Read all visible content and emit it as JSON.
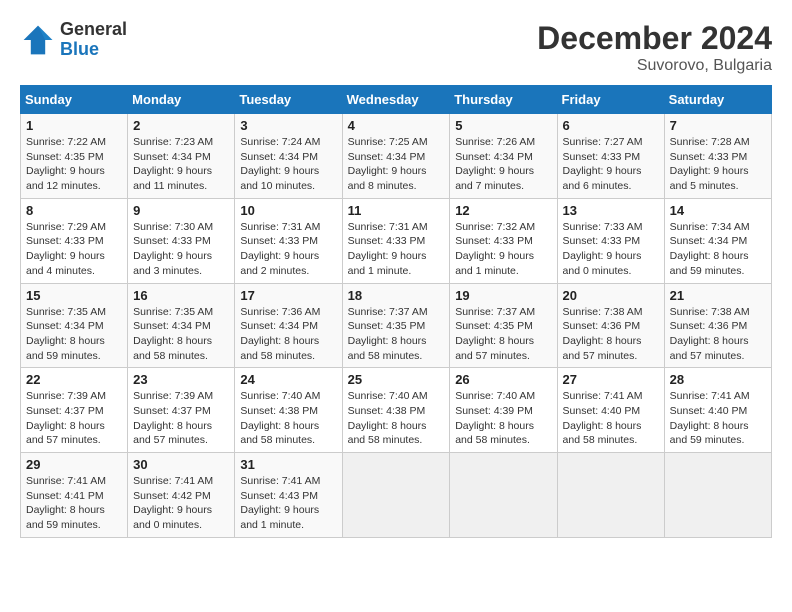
{
  "logo": {
    "line1": "General",
    "line2": "Blue"
  },
  "title": "December 2024",
  "subtitle": "Suvorovo, Bulgaria",
  "weekdays": [
    "Sunday",
    "Monday",
    "Tuesday",
    "Wednesday",
    "Thursday",
    "Friday",
    "Saturday"
  ],
  "weeks": [
    [
      {
        "day": "1",
        "sunrise": "7:22 AM",
        "sunset": "4:35 PM",
        "daylight": "9 hours and 12 minutes."
      },
      {
        "day": "2",
        "sunrise": "7:23 AM",
        "sunset": "4:34 PM",
        "daylight": "9 hours and 11 minutes."
      },
      {
        "day": "3",
        "sunrise": "7:24 AM",
        "sunset": "4:34 PM",
        "daylight": "9 hours and 10 minutes."
      },
      {
        "day": "4",
        "sunrise": "7:25 AM",
        "sunset": "4:34 PM",
        "daylight": "9 hours and 8 minutes."
      },
      {
        "day": "5",
        "sunrise": "7:26 AM",
        "sunset": "4:34 PM",
        "daylight": "9 hours and 7 minutes."
      },
      {
        "day": "6",
        "sunrise": "7:27 AM",
        "sunset": "4:33 PM",
        "daylight": "9 hours and 6 minutes."
      },
      {
        "day": "7",
        "sunrise": "7:28 AM",
        "sunset": "4:33 PM",
        "daylight": "9 hours and 5 minutes."
      }
    ],
    [
      {
        "day": "8",
        "sunrise": "7:29 AM",
        "sunset": "4:33 PM",
        "daylight": "9 hours and 4 minutes."
      },
      {
        "day": "9",
        "sunrise": "7:30 AM",
        "sunset": "4:33 PM",
        "daylight": "9 hours and 3 minutes."
      },
      {
        "day": "10",
        "sunrise": "7:31 AM",
        "sunset": "4:33 PM",
        "daylight": "9 hours and 2 minutes."
      },
      {
        "day": "11",
        "sunrise": "7:31 AM",
        "sunset": "4:33 PM",
        "daylight": "9 hours and 1 minute."
      },
      {
        "day": "12",
        "sunrise": "7:32 AM",
        "sunset": "4:33 PM",
        "daylight": "9 hours and 1 minute."
      },
      {
        "day": "13",
        "sunrise": "7:33 AM",
        "sunset": "4:33 PM",
        "daylight": "9 hours and 0 minutes."
      },
      {
        "day": "14",
        "sunrise": "7:34 AM",
        "sunset": "4:34 PM",
        "daylight": "8 hours and 59 minutes."
      }
    ],
    [
      {
        "day": "15",
        "sunrise": "7:35 AM",
        "sunset": "4:34 PM",
        "daylight": "8 hours and 59 minutes."
      },
      {
        "day": "16",
        "sunrise": "7:35 AM",
        "sunset": "4:34 PM",
        "daylight": "8 hours and 58 minutes."
      },
      {
        "day": "17",
        "sunrise": "7:36 AM",
        "sunset": "4:34 PM",
        "daylight": "8 hours and 58 minutes."
      },
      {
        "day": "18",
        "sunrise": "7:37 AM",
        "sunset": "4:35 PM",
        "daylight": "8 hours and 58 minutes."
      },
      {
        "day": "19",
        "sunrise": "7:37 AM",
        "sunset": "4:35 PM",
        "daylight": "8 hours and 57 minutes."
      },
      {
        "day": "20",
        "sunrise": "7:38 AM",
        "sunset": "4:36 PM",
        "daylight": "8 hours and 57 minutes."
      },
      {
        "day": "21",
        "sunrise": "7:38 AM",
        "sunset": "4:36 PM",
        "daylight": "8 hours and 57 minutes."
      }
    ],
    [
      {
        "day": "22",
        "sunrise": "7:39 AM",
        "sunset": "4:37 PM",
        "daylight": "8 hours and 57 minutes."
      },
      {
        "day": "23",
        "sunrise": "7:39 AM",
        "sunset": "4:37 PM",
        "daylight": "8 hours and 57 minutes."
      },
      {
        "day": "24",
        "sunrise": "7:40 AM",
        "sunset": "4:38 PM",
        "daylight": "8 hours and 58 minutes."
      },
      {
        "day": "25",
        "sunrise": "7:40 AM",
        "sunset": "4:38 PM",
        "daylight": "8 hours and 58 minutes."
      },
      {
        "day": "26",
        "sunrise": "7:40 AM",
        "sunset": "4:39 PM",
        "daylight": "8 hours and 58 minutes."
      },
      {
        "day": "27",
        "sunrise": "7:41 AM",
        "sunset": "4:40 PM",
        "daylight": "8 hours and 58 minutes."
      },
      {
        "day": "28",
        "sunrise": "7:41 AM",
        "sunset": "4:40 PM",
        "daylight": "8 hours and 59 minutes."
      }
    ],
    [
      {
        "day": "29",
        "sunrise": "7:41 AM",
        "sunset": "4:41 PM",
        "daylight": "8 hours and 59 minutes."
      },
      {
        "day": "30",
        "sunrise": "7:41 AM",
        "sunset": "4:42 PM",
        "daylight": "9 hours and 0 minutes."
      },
      {
        "day": "31",
        "sunrise": "7:41 AM",
        "sunset": "4:43 PM",
        "daylight": "9 hours and 1 minute."
      },
      null,
      null,
      null,
      null
    ]
  ],
  "labels": {
    "sunrise": "Sunrise:",
    "sunset": "Sunset:",
    "daylight": "Daylight:"
  }
}
